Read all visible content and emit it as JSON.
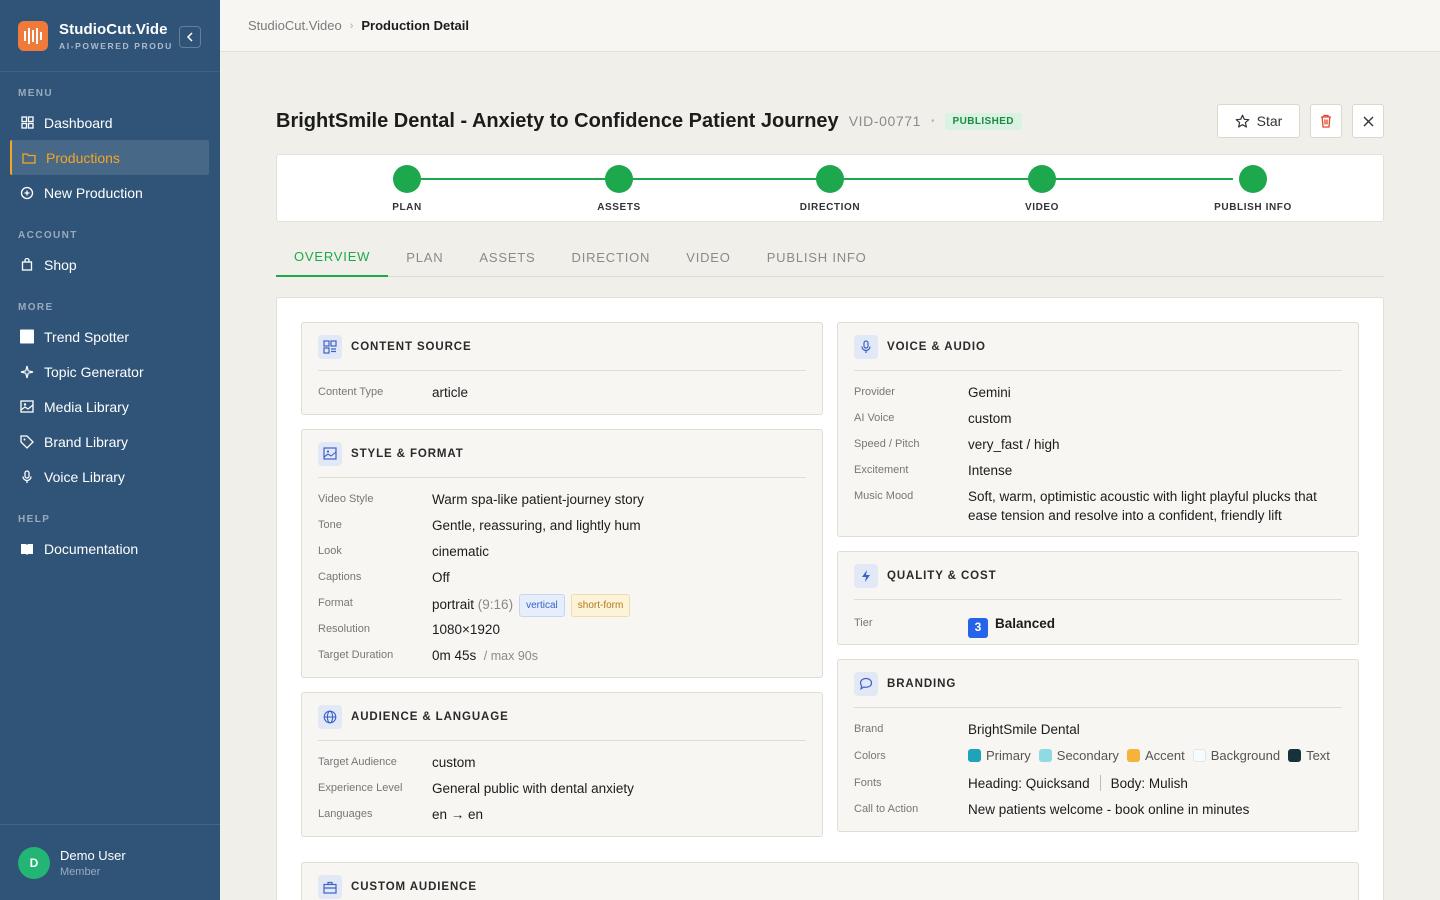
{
  "app": {
    "name": "StudioCut.Vide",
    "subtitle": "AI-POWERED PRODU"
  },
  "sidebar": {
    "menu_label": "MENU",
    "menu": [
      {
        "label": "Dashboard",
        "icon": "grid-icon"
      },
      {
        "label": "Productions",
        "icon": "folder-icon"
      },
      {
        "label": "New Production",
        "icon": "plus-circle-icon"
      }
    ],
    "account_label": "ACCOUNT",
    "account": [
      {
        "label": "Shop",
        "icon": "bag-icon"
      }
    ],
    "more_label": "MORE",
    "more": [
      {
        "label": "Trend Spotter",
        "icon": "square-icon"
      },
      {
        "label": "Topic Generator",
        "icon": "sparkle-icon"
      },
      {
        "label": "Media Library",
        "icon": "image-icon"
      },
      {
        "label": "Brand Library",
        "icon": "tag-icon"
      },
      {
        "label": "Voice Library",
        "icon": "mic-icon"
      }
    ],
    "help_label": "HELP",
    "help": [
      {
        "label": "Documentation",
        "icon": "book-icon"
      }
    ],
    "user": {
      "initial": "D",
      "name": "Demo User",
      "role": "Member"
    }
  },
  "breadcrumb": {
    "root": "StudioCut.Video",
    "current": "Production Detail"
  },
  "production": {
    "title": "BrightSmile Dental - Anxiety to Confidence Patient Journey",
    "id": "VID-00771",
    "status": "PUBLISHED",
    "star_label": "Star"
  },
  "steps": [
    "PLAN",
    "ASSETS",
    "DIRECTION",
    "VIDEO",
    "PUBLISH INFO"
  ],
  "tabs": [
    "OVERVIEW",
    "PLAN",
    "ASSETS",
    "DIRECTION",
    "VIDEO",
    "PUBLISH INFO"
  ],
  "content_source": {
    "title": "CONTENT SOURCE",
    "type_label": "Content Type",
    "type": "article"
  },
  "style": {
    "title": "STYLE & FORMAT",
    "rows": [
      {
        "label": "Video Style",
        "value": "Warm spa-like patient-journey story"
      },
      {
        "label": "Tone",
        "value": "Gentle, reassuring, and lightly hum"
      },
      {
        "label": "Look",
        "value": "cinematic"
      },
      {
        "label": "Captions",
        "value": "Off"
      }
    ],
    "format_label": "Format",
    "format": "portrait",
    "ratio": "(9:16)",
    "chip1": "vertical",
    "chip2": "short-form",
    "resolution_label": "Resolution",
    "resolution": "1080×1920",
    "duration_label": "Target Duration",
    "duration": "0m 45s",
    "duration_max": "/ max 90s"
  },
  "audience": {
    "title": "AUDIENCE & LANGUAGE",
    "rows": [
      {
        "label": "Target Audience",
        "value": "custom"
      },
      {
        "label": "Experience Level",
        "value": "General public with dental anxiety"
      },
      {
        "label": "Languages",
        "value": "en → en"
      }
    ]
  },
  "custom_audience": {
    "title": "CUSTOM AUDIENCE"
  },
  "voice": {
    "title": "VOICE & AUDIO",
    "rows": [
      {
        "label": "Provider",
        "value": "Gemini"
      },
      {
        "label": "AI Voice",
        "value": "custom"
      },
      {
        "label": "Speed / Pitch",
        "value": "very_fast / high"
      },
      {
        "label": "Excitement",
        "value": "Intense"
      },
      {
        "label": "Music Mood",
        "value": "Soft, warm, optimistic acoustic with light playful plucks that ease tension and resolve into a confident, friendly lift"
      }
    ]
  },
  "quality": {
    "title": "QUALITY & COST",
    "tier_label": "Tier",
    "tier_num": "3",
    "tier": "Balanced"
  },
  "branding": {
    "title": "BRANDING",
    "brand_label": "Brand",
    "brand": "BrightSmile Dental",
    "colors_label": "Colors",
    "colors": [
      {
        "name": "Primary",
        "hex": "#1fa3b8"
      },
      {
        "name": "Secondary",
        "hex": "#8fdbe3"
      },
      {
        "name": "Accent",
        "hex": "#f7b23b"
      },
      {
        "name": "Background",
        "hex": "#f6fbfd"
      },
      {
        "name": "Text",
        "hex": "#17323a"
      }
    ],
    "fonts_label": "Fonts",
    "heading_font": "Heading: Quicksand",
    "body_font": "Body: Mulish",
    "cta_label": "Call to Action",
    "cta": "New patients welcome - book online in minutes"
  }
}
